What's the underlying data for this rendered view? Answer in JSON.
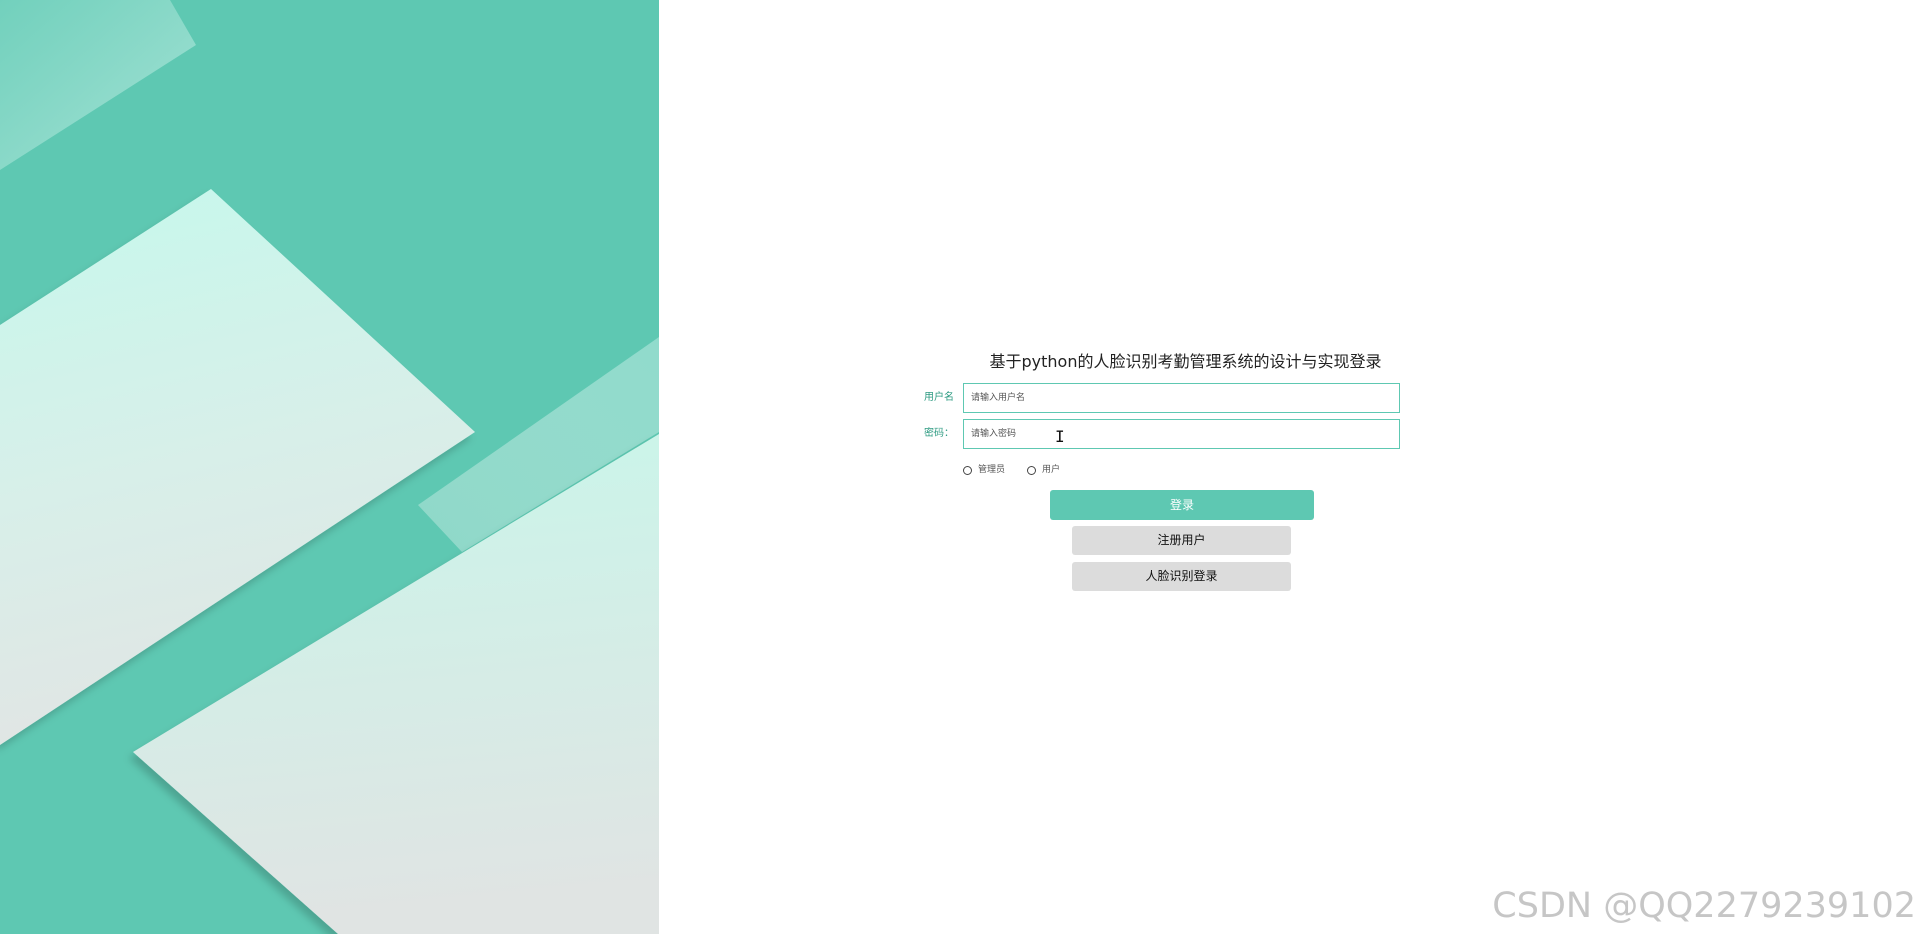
{
  "brand": {
    "accent_color": "#5ec8b2",
    "label_color": "#2e9b82",
    "left_decor_colors": [
      "#5ec8b2",
      "#c8f7ec",
      "#dfe3e2",
      "#a6e3d6"
    ]
  },
  "login_form": {
    "title": "基于python的人脸识别考勤管理系统的设计与实现登录",
    "username": {
      "label": "用户名",
      "placeholder": "请输入用户名"
    },
    "password": {
      "label": "密码：",
      "placeholder": "请输入密码"
    },
    "roles": [
      {
        "label": "管理员",
        "selected": false
      },
      {
        "label": "用户",
        "selected": false
      }
    ],
    "buttons": {
      "login": "登录",
      "register": "注册用户",
      "face_login": "人脸识别登录"
    }
  },
  "watermark": "CSDN @QQ2279239102"
}
